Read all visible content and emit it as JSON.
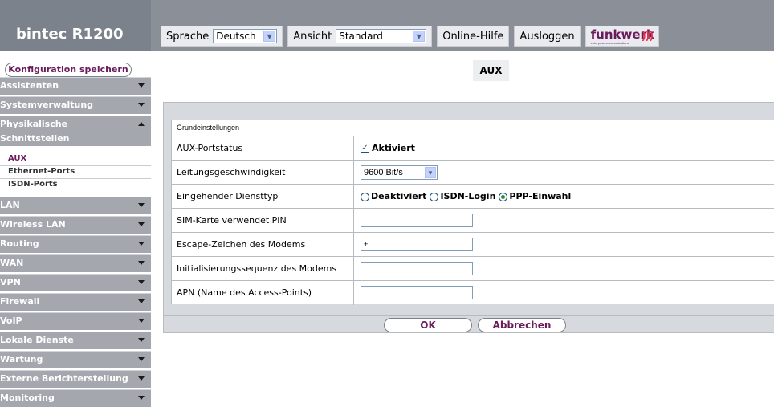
{
  "brand": "bintec R1200",
  "topbar": {
    "language_label": "Sprache",
    "language_value": "Deutsch",
    "view_label": "Ansicht",
    "view_value": "Standard",
    "help_label": "Online-Hilfe",
    "logout_label": "Ausloggen",
    "logo_text": "funkwerk",
    "logo_sub": "enterprise communications"
  },
  "sidebar": {
    "save_label": "Konfiguration speichern",
    "items": [
      {
        "label": "Assistenten"
      },
      {
        "label": "Systemverwaltung"
      },
      {
        "label": "Physikalische Schnittstellen",
        "line1": "Physikalische",
        "line2": "Schnittstellen",
        "expanded": true
      },
      {
        "label": "LAN"
      },
      {
        "label": "Wireless LAN"
      },
      {
        "label": "Routing"
      },
      {
        "label": "WAN"
      },
      {
        "label": "VPN"
      },
      {
        "label": "Firewall"
      },
      {
        "label": "VoIP"
      },
      {
        "label": "Lokale Dienste"
      },
      {
        "label": "Wartung"
      },
      {
        "label": "Externe Berichterstellung"
      },
      {
        "label": "Monitoring"
      }
    ],
    "subitems": [
      {
        "label": "AUX",
        "active": true
      },
      {
        "label": "Ethernet-Ports"
      },
      {
        "label": "ISDN-Ports"
      }
    ]
  },
  "main": {
    "title": "AUX",
    "section": "Grundeinstellungen",
    "fields": {
      "portstatus": {
        "label": "AUX-Portstatus",
        "value": "Aktiviert",
        "checked": true
      },
      "speed": {
        "label": "Leitungsgeschwindigkeit",
        "value": "9600 Bit/s"
      },
      "servicetype": {
        "label": "Eingehender Diensttyp",
        "options": [
          "Deaktiviert",
          "ISDN-Login",
          "PPP-Einwahl"
        ],
        "selected": "PPP-Einwahl"
      },
      "pin": {
        "label": "SIM-Karte verwendet PIN",
        "value": ""
      },
      "escape": {
        "label": "Escape-Zeichen des Modems",
        "value": "+"
      },
      "initseq": {
        "label": "Initialisierungssequenz des Modems",
        "value": ""
      },
      "apn": {
        "label": "APN (Name des Access-Points)",
        "value": ""
      }
    },
    "ok_label": "OK",
    "cancel_label": "Abbrechen"
  },
  "colors": {
    "accent": "#6b1a5c",
    "nav_bg": "#a4a8ae",
    "header_bg": "#8a8f98",
    "panel_bg": "#d6d9dd"
  }
}
